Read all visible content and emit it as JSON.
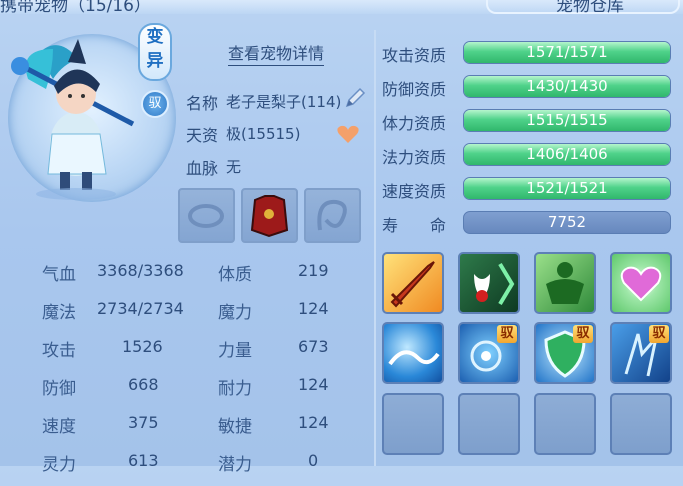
{
  "header": {
    "title_left": "携带宠物（15/16）",
    "title_right": "宠物仓库"
  },
  "pet": {
    "mutation_badge": "变异",
    "mount_badge": "驭",
    "detail_link": "查看宠物详情",
    "name_label": "名称",
    "name_value": "老子是梨子(114)",
    "talent_label": "天资",
    "talent_value": "极(15515)",
    "bloodline_label": "血脉",
    "bloodline_value": "无"
  },
  "attributes": [
    {
      "label": "气血",
      "value": "3368/3368",
      "label2": "体质",
      "value2": "219"
    },
    {
      "label": "魔法",
      "value": "2734/2734",
      "label2": "魔力",
      "value2": "124"
    },
    {
      "label": "攻击",
      "value": "1526",
      "label2": "力量",
      "value2": "673"
    },
    {
      "label": "防御",
      "value": "668",
      "label2": "耐力",
      "value2": "124"
    },
    {
      "label": "速度",
      "value": "375",
      "label2": "敏捷",
      "value2": "124"
    },
    {
      "label": "灵力",
      "value": "613",
      "label2": "潜力",
      "value2": "0"
    }
  ],
  "aptitudes": [
    {
      "label": "攻击资质",
      "value": "1571/1571",
      "fill": 1.0
    },
    {
      "label": "防御资质",
      "value": "1430/1430",
      "fill": 1.0
    },
    {
      "label": "体力资质",
      "value": "1515/1515",
      "fill": 1.0
    },
    {
      "label": "法力资质",
      "value": "1406/1406",
      "fill": 1.0
    },
    {
      "label": "速度资质",
      "value": "1521/1521",
      "fill": 1.0
    }
  ],
  "life": {
    "label": "寿　　命",
    "value": "7752"
  },
  "skills": {
    "mount_tag": "驭",
    "icons": [
      "sword-skill-icon",
      "blood-drop-skill-icon",
      "strongman-skill-icon",
      "heart-skill-icon",
      "water-wave-skill-icon",
      "water-spirit-skill-icon",
      "shield-skill-icon",
      "ice-storm-skill-icon"
    ]
  },
  "colors": {
    "accent": "#2e4e7d",
    "bar_green": "#30b76c",
    "panel": "#a9c7ee"
  }
}
